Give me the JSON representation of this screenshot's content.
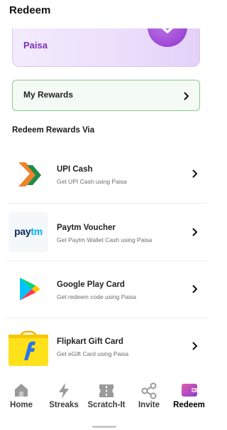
{
  "header": {
    "title": "Redeem"
  },
  "paisa_card": {
    "label": "Paisa"
  },
  "my_rewards": {
    "label": "My Rewards"
  },
  "section": {
    "title": "Redeem Rewards Via"
  },
  "options": [
    {
      "title": "UPI Cash",
      "subtitle": "Get UPI Cash using Paisa",
      "icon": "upi-logo-icon"
    },
    {
      "title": "Paytm Voucher",
      "subtitle": "Get Paytm Wallet Cash using Paisa",
      "icon": "paytm-logo-icon",
      "logo_text": "paytm"
    },
    {
      "title": "Google Play Card",
      "subtitle": "Get redeem code using Paisa",
      "icon": "google-play-logo-icon"
    },
    {
      "title": "Flipkart Gift Card",
      "subtitle": "Get eGift Card using Paisa",
      "icon": "flipkart-logo-icon"
    }
  ],
  "nav": {
    "items": [
      {
        "label": "Home",
        "icon": "home-icon"
      },
      {
        "label": "Streaks",
        "icon": "lightning-icon"
      },
      {
        "label": "Scratch-It",
        "icon": "ticket-icon"
      },
      {
        "label": "Invite",
        "icon": "share-icon"
      },
      {
        "label": "Redeem",
        "icon": "wallet-icon",
        "active": true
      }
    ]
  },
  "colors": {
    "accent_purple": "#7b2fb8",
    "rewards_border": "#8fca91",
    "nav_text": "#3b3b3b"
  }
}
